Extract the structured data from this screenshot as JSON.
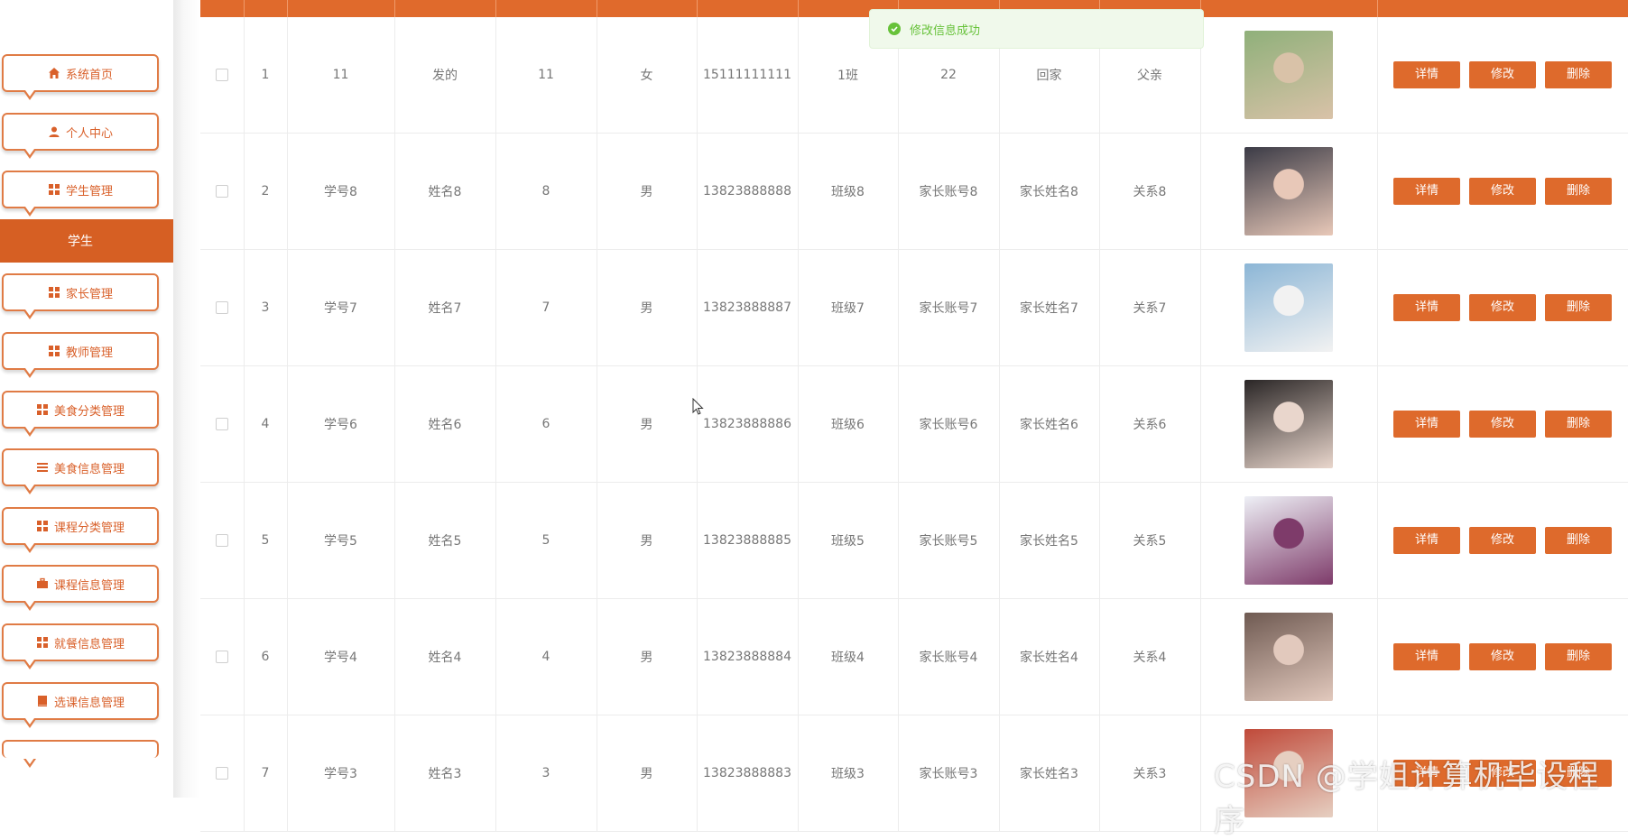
{
  "sidebar": {
    "items": [
      {
        "label": "系统首页",
        "icon": "home-icon"
      },
      {
        "label": "个人中心",
        "icon": "user-icon"
      },
      {
        "label": "学生管理",
        "icon": "grid-icon"
      },
      {
        "label": "家长管理",
        "icon": "grid-icon"
      },
      {
        "label": "教师管理",
        "icon": "grid-icon"
      },
      {
        "label": "美食分类管理",
        "icon": "grid-icon"
      },
      {
        "label": "美食信息管理",
        "icon": "list-icon"
      },
      {
        "label": "课程分类管理",
        "icon": "grid-icon"
      },
      {
        "label": "课程信息管理",
        "icon": "briefcase-icon"
      },
      {
        "label": "就餐信息管理",
        "icon": "grid-icon"
      },
      {
        "label": "选课信息管理",
        "icon": "book-icon"
      }
    ],
    "active_submenu": "学生"
  },
  "toast": {
    "message": "修改信息成功",
    "type": "success"
  },
  "table": {
    "rows": [
      {
        "index": "1",
        "student_id": "11",
        "name": "发的",
        "password": "11",
        "gender": "女",
        "phone": "15111111111",
        "class": "1班",
        "parent_account": "22",
        "parent_name": "回家",
        "relation": "父亲"
      },
      {
        "index": "2",
        "student_id": "学号8",
        "name": "姓名8",
        "password": "8",
        "gender": "男",
        "phone": "13823888888",
        "class": "班级8",
        "parent_account": "家长账号8",
        "parent_name": "家长姓名8",
        "relation": "关系8"
      },
      {
        "index": "3",
        "student_id": "学号7",
        "name": "姓名7",
        "password": "7",
        "gender": "男",
        "phone": "13823888887",
        "class": "班级7",
        "parent_account": "家长账号7",
        "parent_name": "家长姓名7",
        "relation": "关系7"
      },
      {
        "index": "4",
        "student_id": "学号6",
        "name": "姓名6",
        "password": "6",
        "gender": "男",
        "phone": "13823888886",
        "class": "班级6",
        "parent_account": "家长账号6",
        "parent_name": "家长姓名6",
        "relation": "关系6"
      },
      {
        "index": "5",
        "student_id": "学号5",
        "name": "姓名5",
        "password": "5",
        "gender": "男",
        "phone": "13823888885",
        "class": "班级5",
        "parent_account": "家长账号5",
        "parent_name": "家长姓名5",
        "relation": "关系5"
      },
      {
        "index": "6",
        "student_id": "学号4",
        "name": "姓名4",
        "password": "4",
        "gender": "男",
        "phone": "13823888884",
        "class": "班级4",
        "parent_account": "家长账号4",
        "parent_name": "家长姓名4",
        "relation": "关系4"
      },
      {
        "index": "7",
        "student_id": "学号3",
        "name": "姓名3",
        "password": "3",
        "gender": "男",
        "phone": "13823888883",
        "class": "班级3",
        "parent_account": "家长账号3",
        "parent_name": "家长姓名3",
        "relation": "关系3"
      }
    ],
    "actions": {
      "detail": "详情",
      "edit": "修改",
      "delete": "删除"
    }
  },
  "watermark": "CSDN @学姐计算机毕设程序",
  "colors": {
    "accent": "#de6a2c",
    "success": "#67c23a"
  }
}
